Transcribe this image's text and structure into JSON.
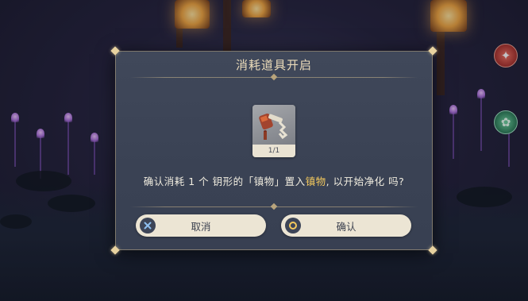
{
  "dialog": {
    "title": "消耗道具开启",
    "item": {
      "icon": "key-item-icon",
      "count": "1/1"
    },
    "message": {
      "before": "确认消耗 1 个 钥形的「镇物」置入",
      "highlight": "镇物",
      "after": ", 以开始净化 吗?"
    },
    "buttons": {
      "cancel_label": "取消",
      "cancel_icon": "cross-icon",
      "confirm_label": "确认",
      "confirm_icon": "circle-icon"
    }
  },
  "hud": {
    "side_icons": [
      "red-element-icon",
      "green-element-icon"
    ]
  },
  "colors": {
    "panel": "#3c4455",
    "title": "#ecdcba",
    "highlight": "#f4c95d",
    "button_bg": "#ece5d4"
  }
}
